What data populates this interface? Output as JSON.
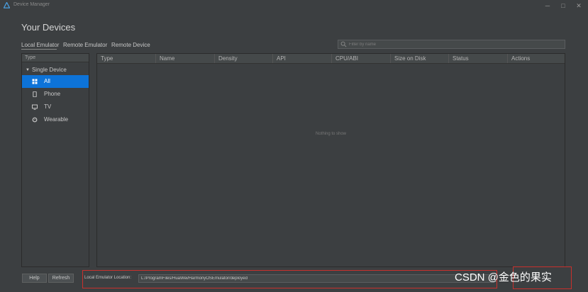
{
  "window": {
    "title": "Device Manager",
    "controls": {
      "minimize": "─",
      "maximize": "□",
      "close": "✕"
    }
  },
  "page_title": "Your Devices",
  "tabs": [
    {
      "label": "Local Emulator",
      "selected": true
    },
    {
      "label": "Remote Emulator",
      "selected": false
    },
    {
      "label": "Remote Device",
      "selected": false
    }
  ],
  "filter": {
    "placeholder": "Filter by name"
  },
  "sidebar": {
    "header": "Type",
    "group": {
      "label": "Single Device",
      "expanded": true
    },
    "items": [
      {
        "label": "All",
        "icon": "grid-icon",
        "selected": true
      },
      {
        "label": "Phone",
        "icon": "phone-icon",
        "selected": false
      },
      {
        "label": "TV",
        "icon": "tv-icon",
        "selected": false
      },
      {
        "label": "Wearable",
        "icon": "watch-icon",
        "selected": false
      }
    ]
  },
  "table": {
    "columns": [
      "Type",
      "Name",
      "Density",
      "API",
      "CPU/ABI",
      "Size on Disk",
      "Status",
      "Actions"
    ],
    "empty_message": "Nothing to show"
  },
  "footer": {
    "help_label": "Help",
    "refresh_label": "Refresh",
    "location_label": "Local Emulator Location:",
    "location_value": "L:/ProgramFiles/HuaWei/HarmonyOSEmulator/deployed"
  },
  "watermark": "CSDN @金色的果实",
  "colors": {
    "background": "#3c3f41",
    "selected": "#0d73d8",
    "highlight_border": "#c9302c"
  }
}
